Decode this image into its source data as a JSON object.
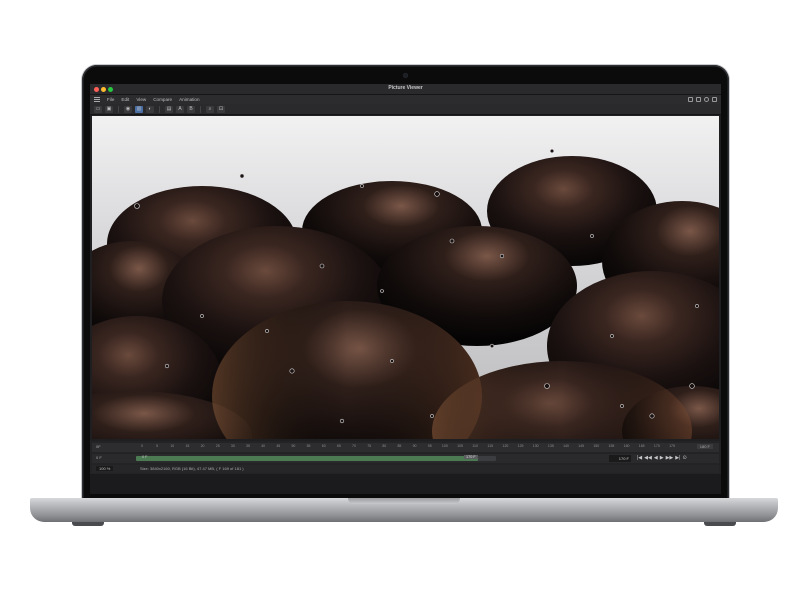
{
  "window": {
    "title": "Picture Viewer"
  },
  "menu": {
    "items": [
      "File",
      "Edit",
      "View",
      "Compare",
      "Animation"
    ]
  },
  "toolbar": {
    "glyph_a": "A",
    "glyph_b": "B"
  },
  "timeline": {
    "start_frame": "0F",
    "end_frame": "180 F",
    "ruler_ticks": [
      "0",
      "5",
      "10",
      "15",
      "20",
      "25",
      "30",
      "35",
      "40",
      "45",
      "50",
      "55",
      "60",
      "65",
      "70",
      "75",
      "80",
      "85",
      "90",
      "95",
      "100",
      "105",
      "110",
      "115",
      "120",
      "125",
      "130",
      "135",
      "140",
      "145",
      "150",
      "155",
      "160",
      "165",
      "170",
      "175"
    ],
    "range_start": "0 F",
    "range_label": "0 F",
    "range_end_mark": "170 F",
    "progress_fraction": 0.95,
    "current_frame": "170 F",
    "transport_glyphs": [
      "|◀",
      "◀◀",
      "◀",
      "▶",
      "▶▶",
      "▶|",
      "⊙"
    ]
  },
  "status": {
    "zoom": "100 %",
    "text": "Size: 3840x2160, RGB (16 Bit), 47.47 MB,  ( F 169 of 181 )"
  },
  "colors": {
    "progress_fill": "#4c7a52",
    "active_tool": "#4a6fa5",
    "close": "#ff5f57",
    "minimize": "#febc2e",
    "zoom": "#28c840"
  },
  "icons": [
    "hamburger-icon",
    "open-folder-icon",
    "save-icon",
    "channel-icon",
    "compare-icon",
    "contrast-icon",
    "histogram-icon",
    "layout-icon",
    "close-icon",
    "minimize-icon",
    "zoom-icon"
  ]
}
